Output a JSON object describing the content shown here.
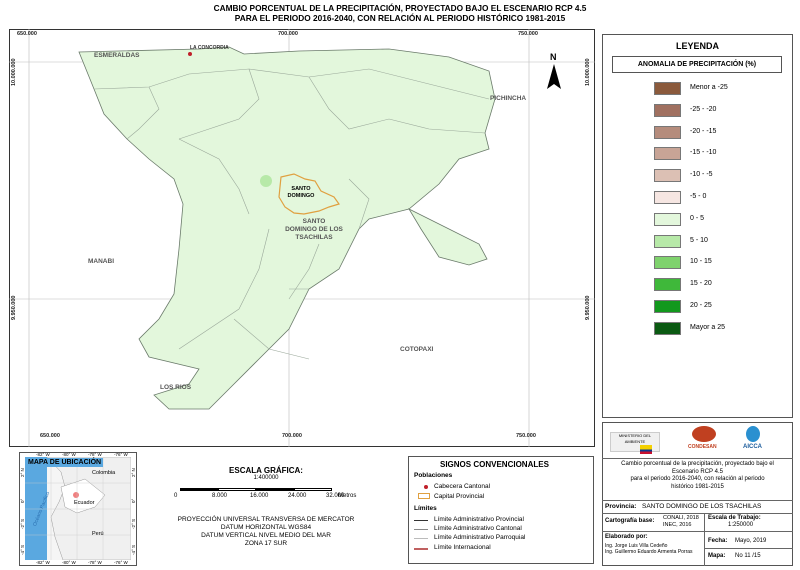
{
  "title": {
    "line1": "CAMBIO PORCENTUAL DE LA PRECIPITACIÓN, PROYECTADO BAJO EL ESCENARIO RCP 4.5",
    "line2": "PARA EL PERIODO 2016-2040, CON RELACIÓN AL PERIODO HISTÓRICO 1981-2015"
  },
  "map": {
    "coords_top": [
      "650.000",
      "700.000",
      "750.000"
    ],
    "coords_bottom": [
      "650.000",
      "700.000",
      "750.000"
    ],
    "coords_left": [
      "10.000.000",
      "9.950.000"
    ],
    "coords_right": [
      "10.000.000",
      "9.950.000"
    ],
    "labels": {
      "esmeraldas": "ESMERALDAS",
      "pichincha": "PICHINCHA",
      "manabi": "MANABI",
      "los_rios": "LOS RIOS",
      "cotopaxi": "COTOPAXI",
      "province_line1": "SANTO",
      "province_line2": "DOMINGO DE LOS",
      "province_line3": "TSACHILAS",
      "capital_line1": "SANTO",
      "capital_line2": "DOMINGO",
      "la_concordia": "LA CONCORDIA",
      "north": "N"
    },
    "fill_color": "#e3f7dc",
    "capital_color": "#e0a040"
  },
  "legend": {
    "title": "LEYENDA",
    "subtitle": "ANOMALIA DE PRECIPITACIÓN (%)",
    "items": [
      {
        "label": "Menor a -25",
        "color": "#8b5a3c"
      },
      {
        "label": "-25 - -20",
        "color": "#a07060"
      },
      {
        "label": "-20 - -15",
        "color": "#b58c7c"
      },
      {
        "label": "-15 - -10",
        "color": "#c8a496"
      },
      {
        "label": "-10 - -5",
        "color": "#dcc0b4"
      },
      {
        "label": "-5 - 0",
        "color": "#f6e6e2"
      },
      {
        "label": "0 - 5",
        "color": "#e3f7dc"
      },
      {
        "label": "5 - 10",
        "color": "#b7e9a8"
      },
      {
        "label": "10 - 15",
        "color": "#7fd26d"
      },
      {
        "label": "15 - 20",
        "color": "#3fb83a"
      },
      {
        "label": "20 - 25",
        "color": "#12981d"
      },
      {
        "label": "Mayor a 25",
        "color": "#0b5a12"
      }
    ]
  },
  "locator": {
    "title": "MAPA DE UBICACIÓN",
    "colombia": "Colombia",
    "ecuador": "Ecuador",
    "peru": "Perú",
    "ocean": "Océano Pacífico",
    "top_coords": [
      "-82° W",
      "-80° W",
      "-78° W",
      "-76° W"
    ],
    "bottom_coords": [
      "-82° W",
      "-80° W",
      "-78° W",
      "-76° W"
    ],
    "left_coords": [
      "2° N",
      "0°",
      "-2° S",
      "-4° S"
    ],
    "right_coords": [
      "2° N",
      "0°",
      "-2° S",
      "-4° S"
    ]
  },
  "scale": {
    "title": "ESCALA GRÁFICA:",
    "ratio": "1:400000",
    "ticks": [
      "0",
      "8.000",
      "16.000",
      "24.000",
      "32.000"
    ],
    "unit": "Metros",
    "projection": [
      "PROYECCIÓN UNIVERSAL TRANSVERSA DE MERCATOR",
      "DATUM HORIZONTAL WGS84",
      "DATUM VERTICAL NIVEL MEDIO DEL MAR",
      "ZONA 17 SUR"
    ]
  },
  "signs": {
    "title": "SIGNOS CONVENCIONALES",
    "poblaciones": "Poblaciones",
    "cabecera": "Cabecera Cantonal",
    "capital": "Capital Provincial",
    "limites": "Límites",
    "lim_prov": "Límite Administrativo Provincial",
    "lim_cant": "Límite Administrativo Cantonal",
    "lim_parr": "Límite Administrativo Parroquial",
    "lim_int": "Límite Internacional"
  },
  "info": {
    "logos": [
      "MINISTERIO DEL AMBIENTE",
      "CONDESAN",
      "AICCA"
    ],
    "description": [
      "Cambio porcentual de la precipitación, proyectado bajo el",
      "Escenario RCP 4.5",
      "para el periodo 2016-2040, con relación al periodo",
      "histórico 1981-2015"
    ],
    "provincia_label": "Provincia:",
    "provincia_value": "SANTO DOMINGO DE LOS TSACHILAS",
    "cartografia_label": "Cartografía base:",
    "cartografia_value1": "CONALI, 2018",
    "cartografia_value2": "INEC, 2016",
    "escala_label": "Escala de Trabajo:",
    "escala_value": "1:250000",
    "elaborado_label": "Elaborado por:",
    "elaborado_1": "Ing. Jorge Luis Villa Cedeño",
    "elaborado_2": "Ing. Guillermo Eduardo Armenta Porras",
    "fecha_label": "Fecha:",
    "fecha_value": "Mayo, 2019",
    "mapa_label": "Mapa:",
    "mapa_value": "No 11 /15"
  }
}
